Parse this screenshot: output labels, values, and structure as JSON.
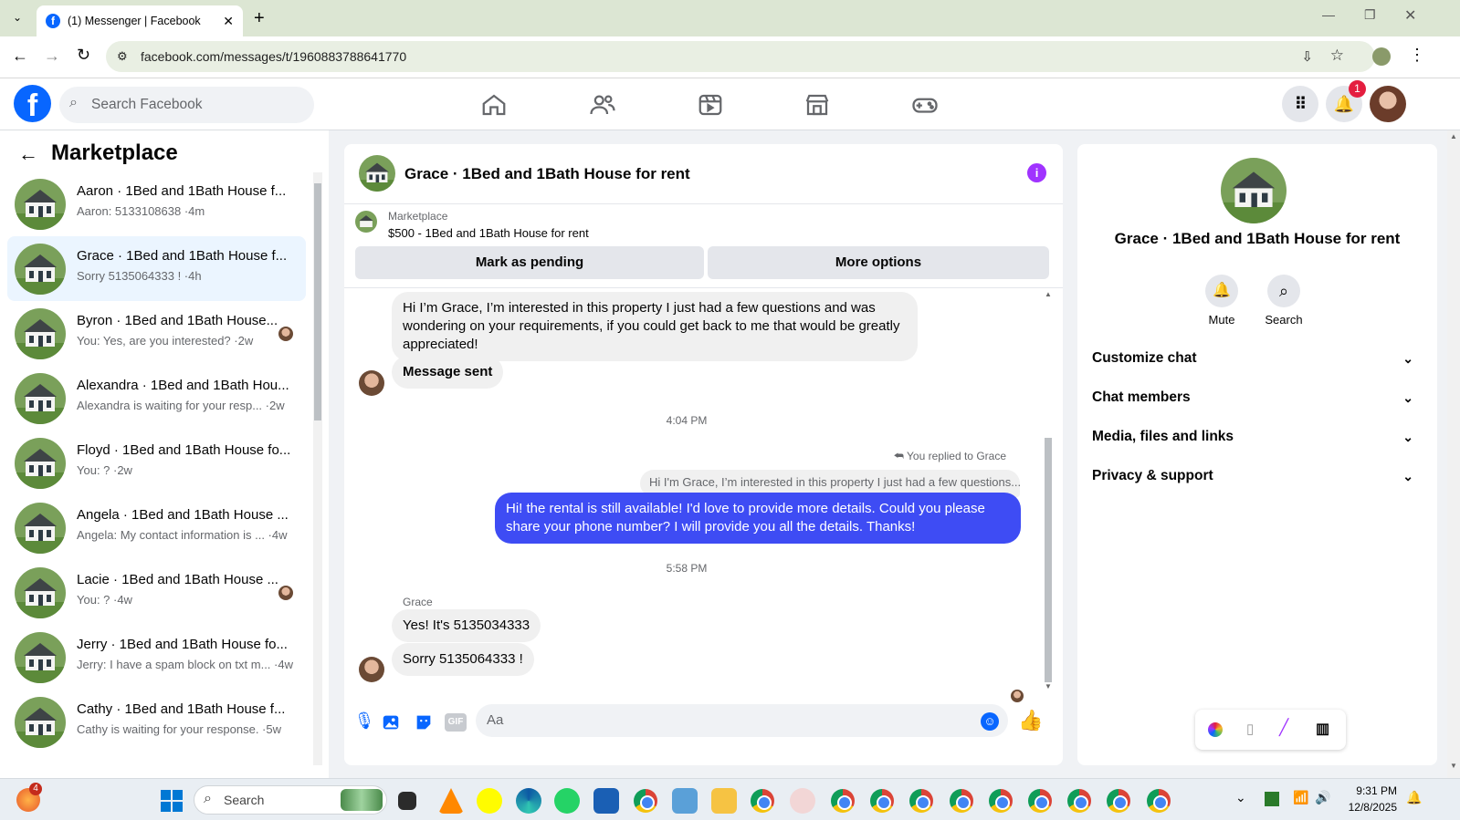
{
  "browser": {
    "tab_title": "(1) Messenger | Facebook",
    "url": "facebook.com/messages/t/1960883788641770"
  },
  "facebook": {
    "search_placeholder": "Search Facebook",
    "notification_count": "1"
  },
  "sidebar": {
    "title": "Marketplace",
    "conversations": [
      {
        "name": "Aaron · 1Bed and 1Bath House f...",
        "preview": "Aaron: 5133108638 ·4m"
      },
      {
        "name": "Grace · 1Bed and 1Bath House f...",
        "preview": "Sorry 5135064333 ! ·4h"
      },
      {
        "name": "Byron · 1Bed and 1Bath House...",
        "preview": "You: Yes, are you interested? ·2w"
      },
      {
        "name": "Alexandra · 1Bed and 1Bath Hou...",
        "preview": "Alexandra is waiting for your resp...  ·2w"
      },
      {
        "name": "Floyd · 1Bed and 1Bath House fo...",
        "preview": "You: ? ·2w"
      },
      {
        "name": "Angela · 1Bed and 1Bath House ...",
        "preview": "Angela: My contact information is ... ·4w"
      },
      {
        "name": "Lacie · 1Bed and 1Bath House ...",
        "preview": "You: ? ·4w"
      },
      {
        "name": "Jerry · 1Bed and 1Bath House fo...",
        "preview": "Jerry: I have a spam block on txt m... ·4w"
      },
      {
        "name": "Cathy · 1Bed and 1Bath House f...",
        "preview": "Cathy is waiting for your response. ·5w"
      }
    ]
  },
  "chat": {
    "header_title": "Grace · 1Bed and 1Bath House for rent",
    "listing_source": "Marketplace",
    "listing_title": "$500 - 1Bed and 1Bath House for rent",
    "mark_pending_label": "Mark as pending",
    "more_options_label": "More options",
    "messages": {
      "grace_first": "Hi I’m Grace, I’m interested in this property I just had a few questions and was wondering on your requirements, if you could get back to me that would be greatly appreciated!",
      "message_sent": "Message sent",
      "time1": "4:04 PM",
      "replied_to": "You replied to Grace",
      "quoted": "Hi I'm Grace, I’m interested in this property I just had a few questions...",
      "my_reply": "Hi! the rental is still available! I'd love to provide more details. Could you please share your phone number? I will provide you all the details. Thanks!",
      "time2": "5:58 PM",
      "sender_label": "Grace",
      "grace_phone": "Yes! It's 5135034333",
      "grace_sorry": "Sorry 5135064333 !"
    },
    "composer_placeholder": "Aa"
  },
  "details": {
    "title": "Grace · 1Bed and 1Bath House for rent",
    "mute_label": "Mute",
    "search_label": "Search",
    "sections": [
      "Customize chat",
      "Chat members",
      "Media, files and links",
      "Privacy & support"
    ]
  },
  "taskbar": {
    "search_label": "Search",
    "widget_badge": "4",
    "time": "9:31 PM",
    "date": "12/8/2025"
  },
  "colors": {
    "fb_blue": "#0866ff",
    "my_bubble": "#3e4cf4",
    "info_purple": "#a033ff"
  }
}
